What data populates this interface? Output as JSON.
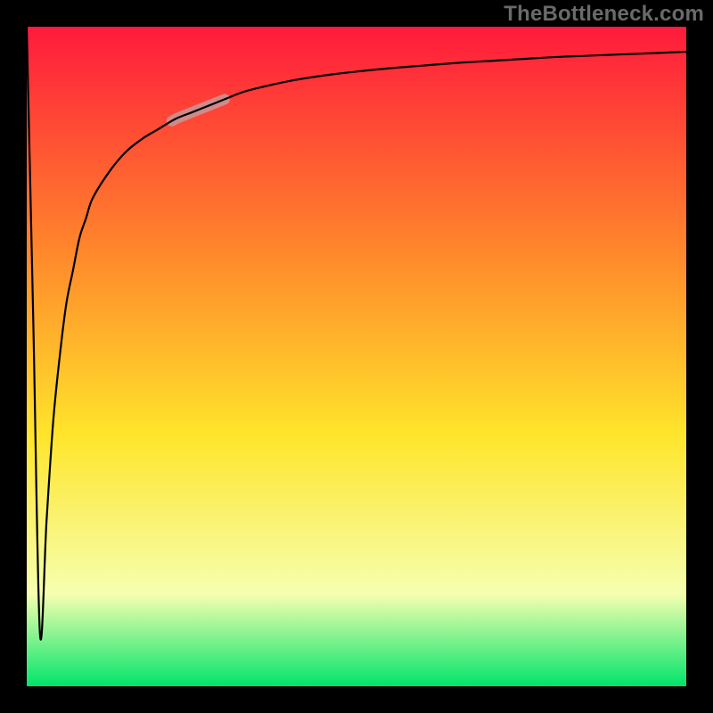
{
  "watermark": "TheBottleneck.com",
  "chart_data": {
    "type": "line",
    "title": "",
    "xlabel": "",
    "ylabel": "",
    "xlim": [
      0,
      100
    ],
    "ylim": [
      0,
      100
    ],
    "grid": false,
    "legend": null,
    "x": [
      0,
      1,
      2,
      3,
      4,
      5,
      6,
      7,
      8,
      9,
      10,
      12.5,
      15,
      17.5,
      20,
      22.5,
      25,
      27.5,
      30,
      32.5,
      35,
      40,
      45,
      50,
      55,
      60,
      65,
      70,
      75,
      80,
      85,
      90,
      95,
      100
    ],
    "values": [
      100,
      55,
      8,
      25,
      40,
      50,
      58,
      63,
      68,
      71,
      74,
      78,
      81,
      83,
      84.5,
      86,
      87,
      88,
      89,
      90,
      90.7,
      91.8,
      92.6,
      93.2,
      93.7,
      94.1,
      94.5,
      94.8,
      95.1,
      95.4,
      95.6,
      95.8,
      96,
      96.2
    ],
    "highlight_segment": {
      "x_start": 22,
      "x_end": 30
    },
    "colors": {
      "gradient_top": "#ff1a3c",
      "gradient_mid1": "#ff8a2b",
      "gradient_mid2": "#ffe52b",
      "gradient_mid3": "#f6ffb0",
      "gradient_bottom": "#00e56a",
      "curve": "#000000",
      "highlight": "#d08a8a"
    }
  }
}
